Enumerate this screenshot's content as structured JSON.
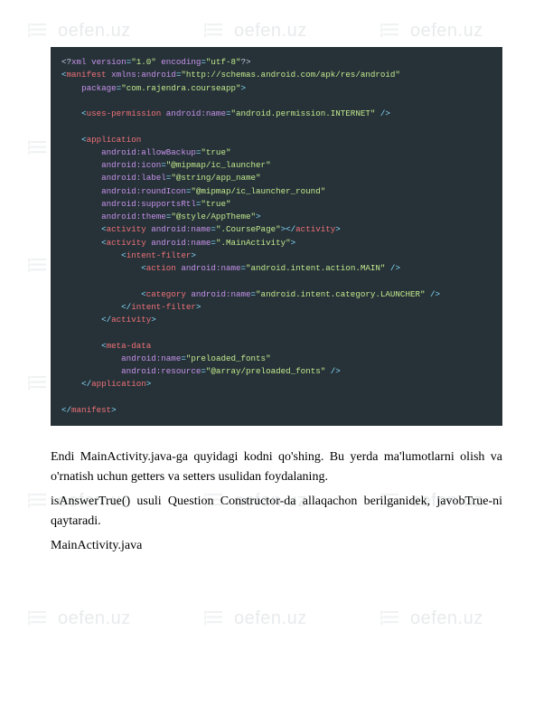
{
  "watermark": "oefen.uz",
  "code_lines": [
    [
      [
        "decl",
        "<?"
      ],
      [
        "attr",
        "xml version"
      ],
      [
        "punc",
        "="
      ],
      [
        "str",
        "\"1.0\""
      ],
      [
        "attr",
        " encoding"
      ],
      [
        "punc",
        "="
      ],
      [
        "str",
        "\"utf-8\""
      ],
      [
        "decl",
        "?>"
      ]
    ],
    [
      [
        "punc",
        "<"
      ],
      [
        "tag",
        "manifest "
      ],
      [
        "attr",
        "xmlns:android"
      ],
      [
        "punc",
        "="
      ],
      [
        "str",
        "\"http://schemas.android.com/apk/res/android\""
      ]
    ],
    [
      [
        "plain",
        "    "
      ],
      [
        "attr",
        "package"
      ],
      [
        "punc",
        "="
      ],
      [
        "str",
        "\"com.rajendra.courseapp\""
      ],
      [
        "punc",
        ">"
      ]
    ],
    [
      [
        "plain",
        ""
      ]
    ],
    [
      [
        "plain",
        "    "
      ],
      [
        "punc",
        "<"
      ],
      [
        "tag",
        "uses-permission "
      ],
      [
        "attr",
        "android:name"
      ],
      [
        "punc",
        "="
      ],
      [
        "str",
        "\"android.permission.INTERNET\""
      ],
      [
        "punc",
        " />"
      ]
    ],
    [
      [
        "plain",
        ""
      ]
    ],
    [
      [
        "plain",
        "    "
      ],
      [
        "punc",
        "<"
      ],
      [
        "tag",
        "application"
      ]
    ],
    [
      [
        "plain",
        "        "
      ],
      [
        "attr",
        "android:allowBackup"
      ],
      [
        "punc",
        "="
      ],
      [
        "str",
        "\"true\""
      ]
    ],
    [
      [
        "plain",
        "        "
      ],
      [
        "attr",
        "android:icon"
      ],
      [
        "punc",
        "="
      ],
      [
        "str",
        "\"@mipmap/ic_launcher\""
      ]
    ],
    [
      [
        "plain",
        "        "
      ],
      [
        "attr",
        "android:label"
      ],
      [
        "punc",
        "="
      ],
      [
        "str",
        "\"@string/app_name\""
      ]
    ],
    [
      [
        "plain",
        "        "
      ],
      [
        "attr",
        "android:roundIcon"
      ],
      [
        "punc",
        "="
      ],
      [
        "str",
        "\"@mipmap/ic_launcher_round\""
      ]
    ],
    [
      [
        "plain",
        "        "
      ],
      [
        "attr",
        "android:supportsRtl"
      ],
      [
        "punc",
        "="
      ],
      [
        "str",
        "\"true\""
      ]
    ],
    [
      [
        "plain",
        "        "
      ],
      [
        "attr",
        "android:theme"
      ],
      [
        "punc",
        "="
      ],
      [
        "str",
        "\"@style/AppTheme\""
      ],
      [
        "punc",
        ">"
      ]
    ],
    [
      [
        "plain",
        "        "
      ],
      [
        "punc",
        "<"
      ],
      [
        "tag",
        "activity "
      ],
      [
        "attr",
        "android:name"
      ],
      [
        "punc",
        "="
      ],
      [
        "str",
        "\".CoursePage\""
      ],
      [
        "punc",
        "></"
      ],
      [
        "tag",
        "activity"
      ],
      [
        "punc",
        ">"
      ]
    ],
    [
      [
        "plain",
        "        "
      ],
      [
        "punc",
        "<"
      ],
      [
        "tag",
        "activity "
      ],
      [
        "attr",
        "android:name"
      ],
      [
        "punc",
        "="
      ],
      [
        "str",
        "\".MainActivity\""
      ],
      [
        "punc",
        ">"
      ]
    ],
    [
      [
        "plain",
        "            "
      ],
      [
        "punc",
        "<"
      ],
      [
        "tag",
        "intent-filter"
      ],
      [
        "punc",
        ">"
      ]
    ],
    [
      [
        "plain",
        "                "
      ],
      [
        "punc",
        "<"
      ],
      [
        "tag",
        "action "
      ],
      [
        "attr",
        "android:name"
      ],
      [
        "punc",
        "="
      ],
      [
        "str",
        "\"android.intent.action.MAIN\""
      ],
      [
        "punc",
        " />"
      ]
    ],
    [
      [
        "plain",
        ""
      ]
    ],
    [
      [
        "plain",
        "                "
      ],
      [
        "punc",
        "<"
      ],
      [
        "tag",
        "category "
      ],
      [
        "attr",
        "android:name"
      ],
      [
        "punc",
        "="
      ],
      [
        "str",
        "\"android.intent.category.LAUNCHER\""
      ],
      [
        "punc",
        " />"
      ]
    ],
    [
      [
        "plain",
        "            "
      ],
      [
        "punc",
        "</"
      ],
      [
        "tag",
        "intent-filter"
      ],
      [
        "punc",
        ">"
      ]
    ],
    [
      [
        "plain",
        "        "
      ],
      [
        "punc",
        "</"
      ],
      [
        "tag",
        "activity"
      ],
      [
        "punc",
        ">"
      ]
    ],
    [
      [
        "plain",
        ""
      ]
    ],
    [
      [
        "plain",
        "        "
      ],
      [
        "punc",
        "<"
      ],
      [
        "tag",
        "meta-data"
      ]
    ],
    [
      [
        "plain",
        "            "
      ],
      [
        "attr",
        "android:name"
      ],
      [
        "punc",
        "="
      ],
      [
        "str",
        "\"preloaded_fonts\""
      ]
    ],
    [
      [
        "plain",
        "            "
      ],
      [
        "attr",
        "android:resource"
      ],
      [
        "punc",
        "="
      ],
      [
        "str",
        "\"@array/preloaded_fonts\""
      ],
      [
        "punc",
        " />"
      ]
    ],
    [
      [
        "plain",
        "    "
      ],
      [
        "punc",
        "</"
      ],
      [
        "tag",
        "application"
      ],
      [
        "punc",
        ">"
      ]
    ],
    [
      [
        "plain",
        ""
      ]
    ],
    [
      [
        "punc",
        "</"
      ],
      [
        "tag",
        "manifest"
      ],
      [
        "punc",
        ">"
      ]
    ]
  ],
  "paragraphs": [
    "Endi MainActivity.java-ga quyidagi kodni qo'shing. Bu yerda ma'lumotlarni olish va o'rnatish uchun getters va setters usulidan foydalaning.",
    "isAnswerTrue() usuli Question Constructor-da allaqachon berilganidek, javobTrue-ni qaytaradi.",
    "MainActivity.java"
  ]
}
